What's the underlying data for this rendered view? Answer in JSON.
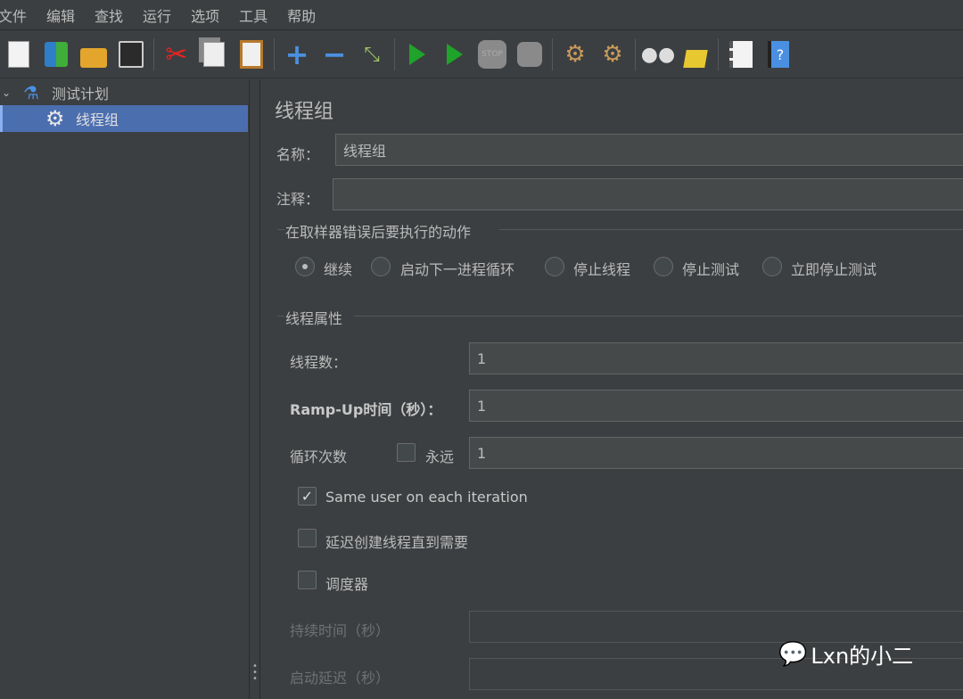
{
  "menu": [
    "文件",
    "编辑",
    "查找",
    "运行",
    "选项",
    "工具",
    "帮助"
  ],
  "toolbar": [
    "new-icon",
    "templates-icon",
    "open-icon",
    "save-icon",
    "cut-icon",
    "copy-icon",
    "paste-icon",
    "expand-icon",
    "collapse-icon",
    "toggle-icon",
    "start-icon",
    "start-no-pauses-icon",
    "stop-icon",
    "shutdown-icon",
    "clear-icon",
    "clear-all-icon",
    "search-icon",
    "reset-search-icon",
    "function-helper-icon",
    "help-icon"
  ],
  "tree": {
    "root": "测试计划",
    "child": "线程组"
  },
  "panel": {
    "title": "线程组",
    "name_label": "名称：",
    "name_value": "线程组",
    "comment_label": "注释：",
    "comment_value": "",
    "error_group": "在取样器错误后要执行的动作",
    "error_options": [
      "继续",
      "启动下一进程循环",
      "停止线程",
      "停止测试",
      "立即停止测试"
    ],
    "error_selected": "继续",
    "thread_group": "线程属性",
    "threads_label": "线程数：",
    "threads_value": "1",
    "rampup_label": "Ramp-Up时间（秒）：",
    "rampup_value": "1",
    "loop_label": "循环次数",
    "forever_label": "永远",
    "forever_checked": false,
    "loop_value": "1",
    "same_user_label": "Same user on each iteration",
    "same_user_checked": true,
    "delay_label": "延迟创建线程直到需要",
    "delay_checked": false,
    "scheduler_label": "调度器",
    "scheduler_checked": false,
    "duration_label": "持续时间（秒）",
    "duration_value": "",
    "startup_delay_label": "启动延迟（秒）",
    "startup_delay_value": ""
  },
  "watermark": "Lxn的小二",
  "colors": {
    "bg": "#3c3f41",
    "field": "#45494a",
    "selection": "#4b6eaf"
  }
}
